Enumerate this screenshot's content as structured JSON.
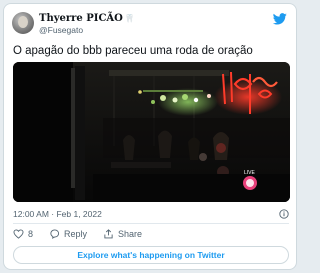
{
  "tweet": {
    "display_name": "Thyerre PICÃO",
    "handle": "@Fusegato",
    "text": "O apagão do bbb pareceu uma roda de oração",
    "timestamp": "12:00 AM · Feb 1, 2022",
    "media_badge": "LIVE"
  },
  "actions": {
    "likes": "8",
    "reply_label": "Reply",
    "share_label": "Share"
  },
  "explore_label": "Explore what's happening on Twitter",
  "icons": {
    "brand": "twitter-bird-icon",
    "like": "heart-icon",
    "reply": "speech-bubble-icon",
    "share": "share-icon",
    "info": "info-icon"
  },
  "colors": {
    "accent": "#1d9bf0",
    "secondary_text": "#536471",
    "border": "#cfd9de"
  }
}
